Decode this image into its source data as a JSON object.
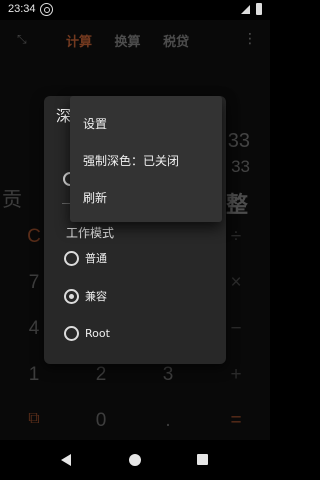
{
  "status": {
    "time": "23:34"
  },
  "tabs": [
    {
      "label": "计算",
      "active": true
    },
    {
      "label": "换算",
      "active": false
    },
    {
      "label": "税贷",
      "active": false
    }
  ],
  "display": {
    "line1": "33",
    "line2": "33",
    "left_fragment": "贡",
    "right_fragment": "整"
  },
  "keypad": {
    "row1": {
      "left": "C",
      "right": "÷"
    },
    "row2": {
      "left": "7",
      "right": "×"
    },
    "row3": {
      "left": "4",
      "right": "−"
    },
    "row4": [
      "1",
      "2",
      "3",
      "+"
    ],
    "row5": {
      "mid": "0",
      "dot": ".",
      "equals": "="
    }
  },
  "dialog": {
    "title_fragment": "深",
    "section_title": "工作模式",
    "options": [
      {
        "label": "普通",
        "checked": false
      },
      {
        "label": "兼容",
        "checked": true
      },
      {
        "label": "Root",
        "checked": false
      }
    ]
  },
  "menu": {
    "items": [
      "设置",
      "强制深色：已关闭",
      "刷新"
    ]
  },
  "colors": {
    "accent": "#d2693a",
    "dialog_bg": "#282828",
    "menu_bg": "#333333"
  }
}
